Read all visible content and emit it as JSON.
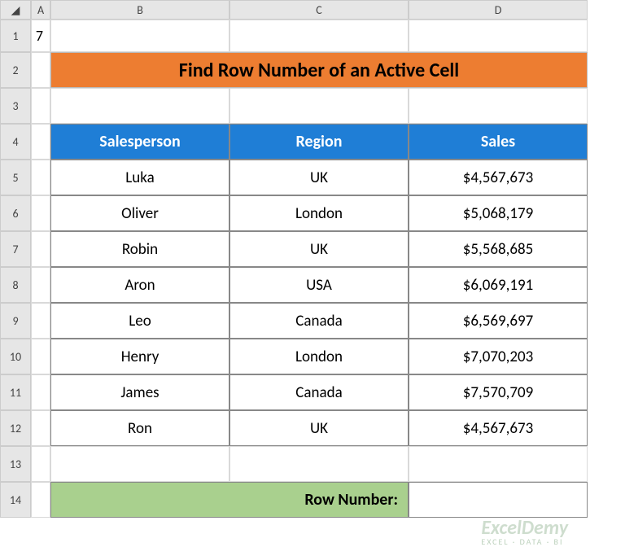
{
  "columns": {
    "corner": "",
    "A": "A",
    "B": "B",
    "C": "C",
    "D": "D"
  },
  "rows": {
    "r1": "1",
    "r2": "2",
    "r3": "3",
    "r4": "4",
    "r5": "5",
    "r6": "6",
    "r7": "7",
    "r8": "8",
    "r9": "9",
    "r10": "10",
    "r11": "11",
    "r12": "12",
    "r13": "13",
    "r14": "14"
  },
  "A1_value": "7",
  "title": "Find Row Number of an Active Cell",
  "headers": {
    "salesperson": "Salesperson",
    "region": "Region",
    "sales": "Sales"
  },
  "data": [
    {
      "name": "Luka",
      "region": "UK",
      "sales": "$4,567,673"
    },
    {
      "name": "Oliver",
      "region": "London",
      "sales": "$5,068,179"
    },
    {
      "name": "Robin",
      "region": "UK",
      "sales": "$5,568,685"
    },
    {
      "name": "Aron",
      "region": "USA",
      "sales": "$6,069,191"
    },
    {
      "name": "Leo",
      "region": "Canada",
      "sales": "$6,569,697"
    },
    {
      "name": "Henry",
      "region": "London",
      "sales": "$7,070,203"
    },
    {
      "name": "James",
      "region": "Canada",
      "sales": "$7,570,709"
    },
    {
      "name": "Ron",
      "region": "UK",
      "sales": "$4,567,673"
    }
  ],
  "row_number_label": "Row Number:",
  "row_number_value": "",
  "watermark": {
    "brand": "ExcelDemy",
    "tag": "EXCEL · DATA · BI"
  }
}
